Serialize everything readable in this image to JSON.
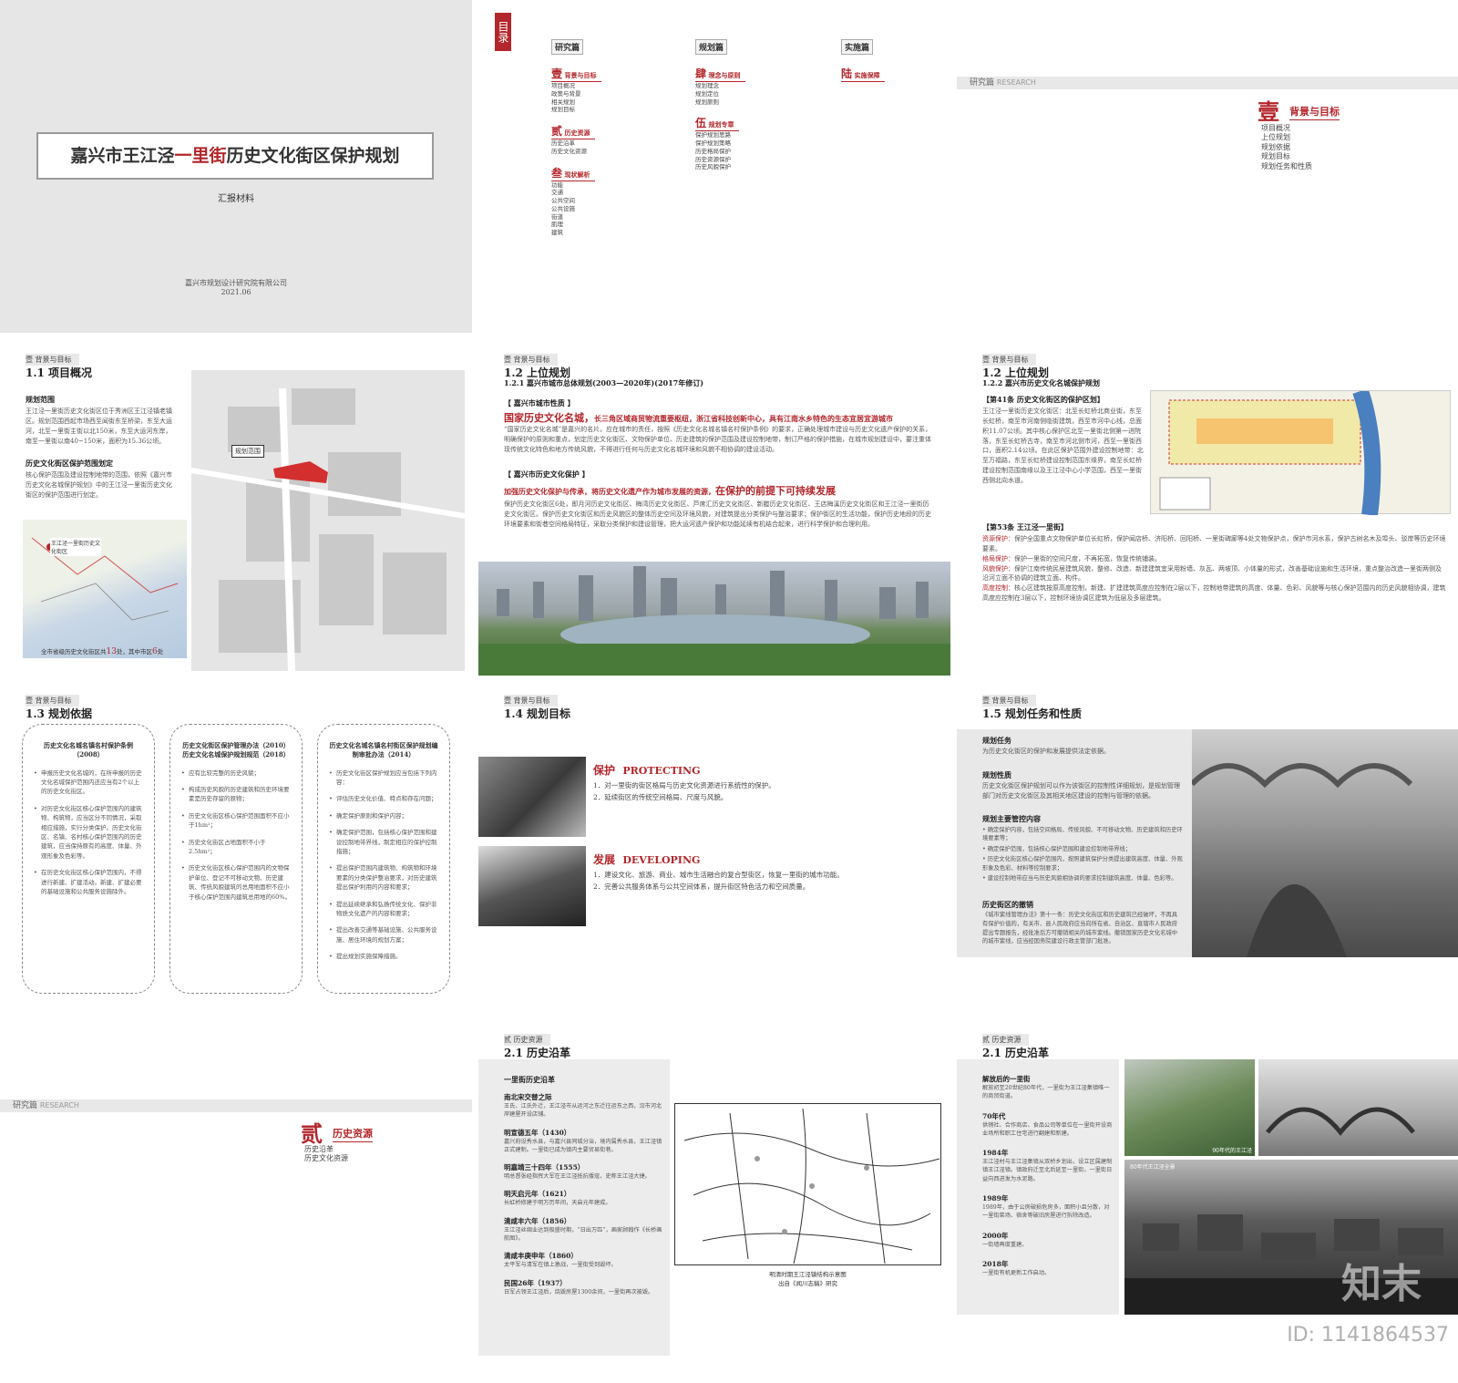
{
  "cover": {
    "title_a": "嘉兴市王江泾",
    "title_red": "一里街",
    "title_b": "历史文化街区保护规划",
    "subtitle": "汇报材料",
    "org": "嘉兴市规划设计研究院有限公司",
    "date": "2021.06"
  },
  "toc": {
    "label": "目录",
    "cols": [
      {
        "head": "研究篇",
        "groups": [
          {
            "num": "壹",
            "name": "背景与目标",
            "items": [
              "项目概况",
              "政策与背景",
              "相关规划",
              "规划目标"
            ]
          },
          {
            "num": "贰",
            "name": "历史资源",
            "items": [
              "历史沿革",
              "历史文化资源"
            ]
          },
          {
            "num": "叁",
            "name": "现状解析",
            "items": [
              "功能",
              "交通",
              "公共空间",
              "公共设施",
              "街道",
              "肌理",
              "建筑"
            ]
          }
        ]
      },
      {
        "head": "规划篇",
        "groups": [
          {
            "num": "肆",
            "name": "理念与原则",
            "items": [
              "规划理念",
              "规划定位",
              "规划原则"
            ]
          },
          {
            "num": "伍",
            "name": "规划专章",
            "items": [
              "保护规划思路",
              "保护规划策略",
              "历史格局保护",
              "历史资源保护",
              "历史风貌保护"
            ]
          }
        ]
      },
      {
        "head": "实施篇",
        "groups": [
          {
            "num": "陆",
            "name": "实施保障",
            "items": []
          }
        ]
      }
    ]
  },
  "research1": {
    "bar": "研究篇",
    "bar_en": "RESEARCH",
    "num": "壹",
    "name": "背景与目标",
    "items": [
      "项目概况",
      "上位规划",
      "规划依据",
      "规划目标",
      "规划任务和性质"
    ]
  },
  "p11": {
    "sec": "壹 背景与目标",
    "title": "1.1 项目概况",
    "h1": "规划范围",
    "t1": "王江泾一里街历史文化街区位于秀洲区王江泾镇老镇区。规划范围西起市场西至闻街东至桥梁，东至大运河，北至一里街主街以北150米，东至大运河东岸，南至一里街以南40~150米，面积为15.36公顷。",
    "h2": "历史文化街区保护范围划定",
    "t2": "核心保护范围及建设控制地带的范围，依照《嘉兴市历史文化名城保护规划》中的王江泾一里街历史文化街区的保护范围进行划定。",
    "map_label": "规划范围",
    "mini_label": "王江泾一里街历史文化街区",
    "caption_a": "全市省级历史文化街区共",
    "caption_n1": "13",
    "caption_b": "处，其中市区",
    "caption_n2": "6",
    "caption_c": "处"
  },
  "p12a": {
    "sec": "壹 背景与目标",
    "title": "1.2 上位规划",
    "sub": "1.2.1 嘉兴市城市总体规划(2003—2020年)(2017年修订)",
    "h1": "【 嘉兴市城市性质 】",
    "hl1a": "国家历史文化名城，",
    "hl1b": "长三角区域商贸物流重要枢纽，浙江省科技创新中心，具有江南水乡特色的生态宜居宜游城市",
    "t1": "“国家历史文化名城”是嘉兴的名片。应在城市的责任，按照《历史文化名城名镇名村保护条例》的要求，正确处理城市建设与历史文化遗产保护的关系，明确保护的原则和重点，划定历史文化街区、文物保护单位、历史建筑的保护范围及建设控制地带，制订严格的保护措施，在城市规划建设中，要注重体现传统文化特色和地方传统风貌，不得进行任何与历史文化名城环境和风貌不相协调的建设活动。",
    "h2": "【 嘉兴市历史文化保护 】",
    "hl2a": "加强历史文化保护与传承，将历史文化遗产作为城市发展的资源，",
    "hl2b": "在保护的前提下可持续发展",
    "t2": "保护历史文化街区6处，即月河历史文化街区、梅湾历史文化街区、芦席汇历史文化街区、新塍历史文化街区、王店梅溪历史文化街区和王江泾一里街历史文化街区。保护历史文化街区和历史风貌区的整体历史空间及环境风貌，对建筑提出分类保护与整治要求；保护街区的生活功能，保护历史地段的历史环境要素和街巷空间格局特征，采取分类保护和建设管理，把大运河遗产保护和功能延续有机结合起来，进行科学保护和合理利用。"
  },
  "p12b": {
    "sec": "壹 背景与目标",
    "title": "1.2 上位规划",
    "sub": "1.2.2 嘉兴市历史文化名城保护规划",
    "h1": "【第41条 历史文化街区的保护区划】",
    "t1": "王江泾一里街历史文化街区：北至长虹桥北商业街，东至长虹桥，南至市河南侧临街建筑，西至市河中心线，总面积11.07公顷。其中核心保护区北至一里街北侧第一进院落，东至长虹桥古寺，南至市河北侧市河，西至一里街西口，面积2.14公顷。在此区保护范围外建设控制地带：北至万福路，东至长虹桥建设控制范围东缘界，南至长虹桥建设控制范围南缘以及王江泾中心小学范围，西至一里街西侧北向水道。",
    "h2": "【第53条 王江泾一里街】",
    "r1": "资源保护：",
    "t2a": "保护全国重点文物保护单位长虹桥，保护闻店桥、济阳桥、回阳桥、一里街碑廊等4处文物保护点，保护市河水系，保护古树名木及埠头、驳岸等历史环境要素。",
    "r2": "格局保护：",
    "t2b": "保护一里街的空间尺度，不再拓宽，恢复传统铺装。",
    "r3": "风貌保护：",
    "t2c": "保护江南传统民居建筑风貌，整修、改造、新建建筑宜采用粉墙、灰瓦、两坡顶、小体量的形式，改善基础设施和生活环境，重点整治改造一里街两侧及沿河立面不协调的建筑立面、构件。",
    "r4": "高度控制：",
    "t2d": "核心区建筑按原高度控制，新建、扩建建筑高度应控制在2层以下，控制地带建筑的高度、体量、色彩、风貌等与核心保护范围内的历史风貌相协调，建筑高度应控制在3层以下，控制环境协调区建筑为低层及多层建筑。"
  },
  "p13": {
    "sec": "壹 背景与目标",
    "title": "1.3 规划依据",
    "cards": [
      {
        "title": "历史文化名城名镇名村保护条例（2008）",
        "items": [
          "申报历史文化名城的，在所申报的历史文化名城保护范围内还应当有2个以上的历史文化街区。",
          "对历史文化街区核心保护范围内的建筑物、构筑物，应当区分不同情况，采取相应措施，实行分类保护。历史文化街区、名镇、名村核心保护范围内的历史建筑，应当保持原有的高度、体量、外观形象及色彩等。",
          "在历史文化街区核心保护范围内，不得进行新建、扩建活动。新建、扩建必要的基础设施和公共服务设施除外。"
        ]
      },
      {
        "title": "历史文化街区保护管理办法（2010）历史文化名城保护规划规范（2018）",
        "items": [
          "应有比较完整的历史风貌；",
          "构成历史风貌的历史建筑和历史环境要素是历史存留的原物；",
          "历史文化街区核心保护范围面积不应小于1hm²；",
          "历史文化街区占地面积不小于2.5hm²；",
          "历史文化街区核心保护范围内的文物保护单位、登记不可移动文物、历史建筑、传统风貌建筑的总用地面积不应小于核心保护范围内建筑总用地的60%。"
        ]
      },
      {
        "title": "历史文化名城名镇名村街区保护规划编制审批办法（2014）",
        "items": [
          "历史文化街区保护规划应当包括下列内容：",
          "评估历史文化价值、特点和存在问题；",
          "确定保护原则和保护内容；",
          "确定保护范围，包括核心保护范围和建设控制地带界线，制定相应的保护控制措施；",
          "提出保护范围内建筑物、构筑物和环境要素的分类保护整治要求，对历史建筑提出保护利用的内容和要求；",
          "提出延续继承和弘扬传统文化、保护非物质文化遗产的内容和要求；",
          "提出改善交通等基础设施、公共服务设施、居住环境的规划方案；",
          "提出规划实施保障措施。"
        ]
      }
    ]
  },
  "p14": {
    "sec": "壹 背景与目标",
    "title": "1.4 规划目标",
    "g1_cn": "保护",
    "g1_en": "PROTECTING",
    "g1_items": [
      "1．对一里街的街区格局与历史文化资源进行系统性的保护。",
      "2．延续街区的传统空间格局、尺度与风貌。"
    ],
    "g2_cn": "发展",
    "g2_en": "DEVELOPING",
    "g2_items": [
      "1．建设文化、旅游、商业、城市生活融合的复合型街区，恢复一里街的城市功能。",
      "2．完善公共服务体系与公共空间体系，提升街区特色活力和空间质量。"
    ]
  },
  "p15": {
    "sec": "壹 背景与目标",
    "title": "1.5 规划任务和性质",
    "h1": "规划任务",
    "t1": "为历史文化街区的保护和发展提供法定依据。",
    "h2": "规划性质",
    "t2": "历史文化街区保护规划可以作为该街区的控制性详细规划，是规划管理部门对历史文化街区及其相关地区建设的控制与管理的依据。",
    "h3": "规划主要管控内容",
    "items": [
      "确定保护内容，包括空间格局、传统风貌、不可移动文物、历史建筑和历史环境要素等；",
      "确定保护范围，包括核心保护范围和建设控制地带界线；",
      "历史文化街区核心保护范围内，按照建筑保护分类提出建筑高度、体量、外观形象及色彩、材料等控制要求；",
      "建设控制地带应当与历史风貌相协调的要求控制建筑高度、体量、色彩等。"
    ],
    "h4": "历史街区的撤销",
    "t4": "《城市紫线管理办法》第十一条：历史文化街区和历史建筑已经破坏，不再具有保护价值的，有关市、县人民政府应当向所在省、自治区、直辖市人民政府提出专题报告，经批准后方可撤销相关的城市紫线。撤销国家历史文化名城中的城市紫线，应当经国务院建设行政主管部门批准。"
  },
  "research2": {
    "bar": "研究篇",
    "bar_en": "RESEARCH",
    "num": "贰",
    "name": "历史资源",
    "items": [
      "历史沿革",
      "历史文化资源"
    ]
  },
  "p21a": {
    "sec": "贰 历史资源",
    "title": "2.1 历史沿革",
    "head": "一里街历史沿革",
    "entries": [
      {
        "h": "南北宋交替之际",
        "t": "王氏、江氏外迁，王江泾市从运河之东迁往运东之西，沿市河北岸建屋开设店铺。"
      },
      {
        "h": "明宣德五年（1430）",
        "t": "嘉兴府设秀水县，与嘉兴县同城分治，境内属秀水县，王江泾镇正式建制。一里街已成为镇内主要贸易街巷。"
      },
      {
        "h": "明嘉靖三十四年（1555）",
        "t": "明总督张经指挥大军在王江泾抵抗倭寇，史称王江泾大捷。"
      },
      {
        "h": "明天启元年（1621）",
        "t": "长虹桥修建于明万历年间，天启元年建成。"
      },
      {
        "h": "清咸丰六年（1856）",
        "t": "王江泾丝绸业达到极盛时期，“日出万匹”，画家顾翰作《长桥画航图》。"
      },
      {
        "h": "清咸丰庚申年（1860）",
        "t": "太平军与清军在镇上激战，一里街受到毁坏。"
      },
      {
        "h": "民国26年（1937）",
        "t": "日军占领王江泾后，烧毁房屋1300余间，一里街再次被毁。"
      }
    ],
    "map_caption": "明清时期王江泾镇结构示意图",
    "map_source": "出自《闻川志稿》研究"
  },
  "p21b": {
    "sec": "贰 历史资源",
    "title": "2.1 历史沿革",
    "entries": [
      {
        "h": "解放后的一里街",
        "t": "解放初至20世纪80年代，一里街为王江泾集镇唯一的商贸街道。"
      },
      {
        "h": "70年代",
        "t": "供销社、合作商店、食品公司等单位在一里街开设商业场所和职工住宅进行翻建和新建。"
      },
      {
        "h": "1984年",
        "t": "王江泾村与王江泾集镇从双桥乡划出，设立区属建制镇王江泾镇。镇政府迁至北后延至一里街，一里街日益向西进发为水泥路。"
      },
      {
        "h": "1989年",
        "t": "1989年，由于公房破损危房多，面积小且分散，对一里街菜场、宿舍等破旧房屋进行拆除改造。"
      },
      {
        "h": "2000年",
        "t": "一街墙再度重建。"
      },
      {
        "h": "2018年",
        "t": "一里街有机更新工作启动。"
      }
    ],
    "photo1_caption": "90年代的王江泾",
    "photo3_caption": "80年代王江泾全景"
  },
  "footer": {
    "logo": "知末",
    "id": "ID: 1141864537"
  }
}
